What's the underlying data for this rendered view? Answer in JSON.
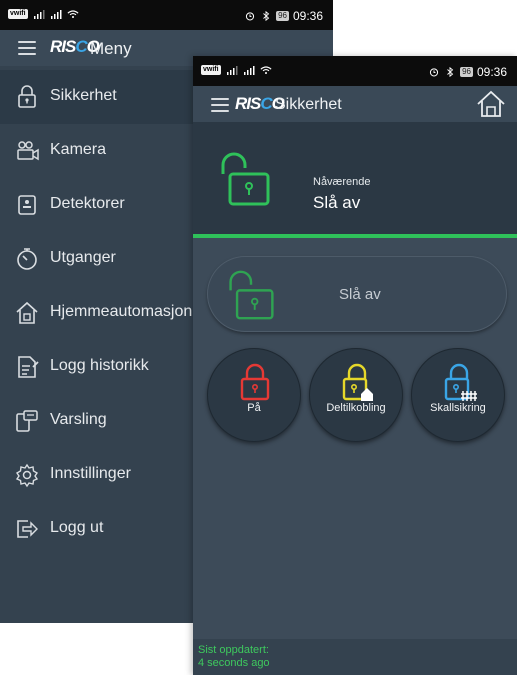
{
  "status_bar": {
    "carrier": "vwifi",
    "battery": "96",
    "time": "09:36"
  },
  "menu_screen": {
    "logo": "RISCO",
    "title": "Meny",
    "items": [
      {
        "label": "Sikkerhet",
        "icon": "padlock-icon",
        "active": true
      },
      {
        "label": "Kamera",
        "icon": "camera-icon"
      },
      {
        "label": "Detektorer",
        "icon": "detector-icon"
      },
      {
        "label": "Utganger",
        "icon": "timer-icon"
      },
      {
        "label": "Hjemmeautomasjon",
        "icon": "home-automation-icon"
      },
      {
        "label": "Logg historikk",
        "icon": "log-history-icon"
      },
      {
        "label": "Varsling",
        "icon": "notification-icon"
      },
      {
        "label": "Innstillinger",
        "icon": "settings-icon"
      },
      {
        "label": "Logg ut",
        "icon": "logout-icon"
      }
    ]
  },
  "security_screen": {
    "logo": "RISCO",
    "title": "Sikkerhet",
    "current": {
      "caption": "Nåværende",
      "value": "Slå av"
    },
    "disarm_button": "Slå av",
    "modes": [
      {
        "label": "På",
        "color": "#e53935"
      },
      {
        "label": "Deltilkobling",
        "color": "#e6d82a"
      },
      {
        "label": "Skallsikring",
        "color": "#3aa5e6"
      }
    ],
    "last_updated": {
      "label": "Sist oppdatert:",
      "value": "4 seconds ago"
    }
  },
  "colors": {
    "armed_off_green": "#2fc15a",
    "brand_blue": "#3aa5e6",
    "background": "#3d4b59"
  }
}
